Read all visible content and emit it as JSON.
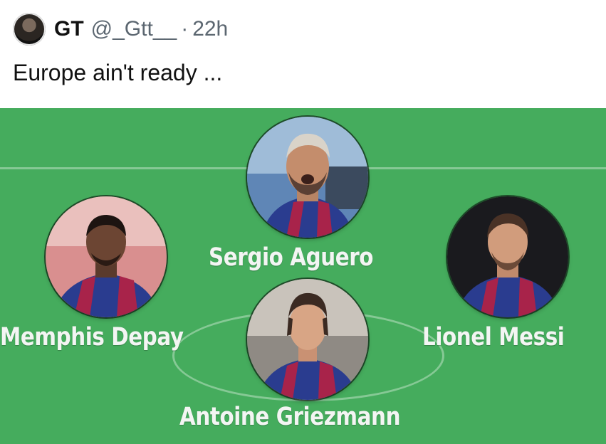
{
  "tweet": {
    "display_name": "GT",
    "handle": "@_Gtt__",
    "separator": "·",
    "timestamp": "22h",
    "text": "Europe ain't ready ..."
  },
  "lineup": {
    "players": [
      {
        "name": "Sergio Aguero"
      },
      {
        "name": "Memphis Depay"
      },
      {
        "name": "Lionel Messi"
      },
      {
        "name": "Antoine Griezmann"
      }
    ]
  },
  "colors": {
    "pitch": "#45ac5d",
    "kit_blue": "#2a3c8f",
    "kit_red": "#a8234a"
  }
}
